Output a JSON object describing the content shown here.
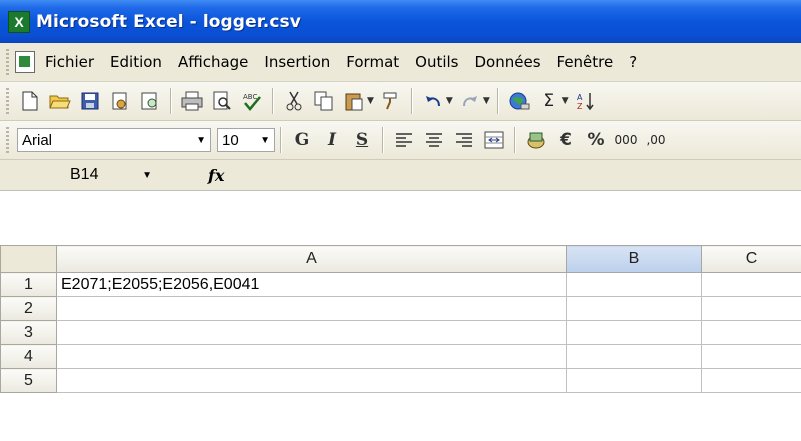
{
  "window": {
    "title": "Microsoft Excel - logger.csv",
    "app_icon_glyph": "X",
    "title_bar_color": "#0a55da"
  },
  "menu": {
    "items": [
      "Fichier",
      "Edition",
      "Affichage",
      "Insertion",
      "Format",
      "Outils",
      "Données",
      "Fenêtre",
      "?"
    ]
  },
  "toolbar_standard": {
    "icons": [
      "new-document-icon",
      "open-folder-icon",
      "save-icon",
      "permission-icon",
      "research-icon",
      "print-icon",
      "print-preview-icon",
      "spelling-icon",
      "cut-icon",
      "copy-icon",
      "paste-icon",
      "format-painter-icon",
      "undo-icon",
      "redo-icon",
      "hyperlink-icon",
      "autosum-icon",
      "insert-function-icon"
    ],
    "autosum_label": "Σ"
  },
  "toolbar_format": {
    "font_name": "Arial",
    "font_size": "10",
    "bold_label": "G",
    "italic_label": "I",
    "underline_label": "S",
    "euro_label": "€",
    "percent_label": "%",
    "thousands_label": "000",
    "decimal_label": ",00"
  },
  "formula_bar": {
    "name_box": "B14",
    "fx_label": "fx",
    "content": ""
  },
  "sheet": {
    "columns": [
      "A",
      "B",
      "C"
    ],
    "selected_column": "B",
    "rows": [
      {
        "num": "1",
        "cells": [
          "E2071;E2055;E2056,E0041",
          "",
          ""
        ]
      },
      {
        "num": "2",
        "cells": [
          "",
          "",
          ""
        ]
      },
      {
        "num": "3",
        "cells": [
          "",
          "",
          ""
        ]
      },
      {
        "num": "4",
        "cells": [
          "",
          "",
          ""
        ]
      },
      {
        "num": "5",
        "cells": [
          "",
          "",
          ""
        ]
      }
    ]
  }
}
